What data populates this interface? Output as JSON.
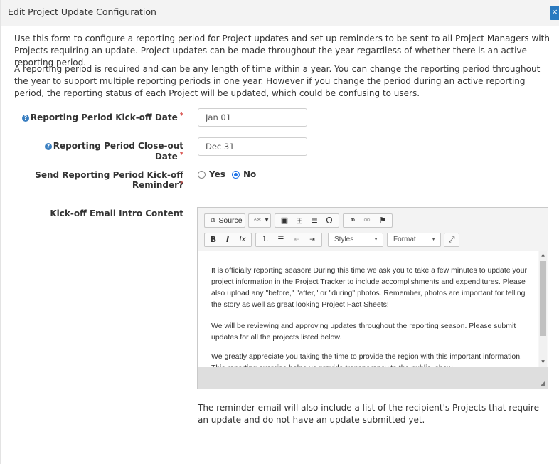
{
  "modal": {
    "title": "Edit Project Update Configuration",
    "close_label": "×"
  },
  "intro": {
    "paragraph1": "Use this form to configure a reporting period for Project updates and set up reminders to be sent to all Project Managers with Projects requiring an update. Project updates can be made throughout the year regardless of whether there is an active reporting period.",
    "paragraph2": "A reporting period is required and can be any length of time within a year. You can change the reporting period throughout the year to support multiple reporting periods in one year. However if you change the period during an active reporting period, the reporting status of each Project will be updated, which could be confusing to users."
  },
  "form": {
    "kickoff_label": "Reporting Period Kick-off Date",
    "kickoff_value": "Jan 01",
    "closeout_label": "Reporting Period Close-out Date",
    "closeout_value": "Dec 31",
    "reminder_label": "Send Reporting Period Kick-off Reminder?",
    "required_mark": "*",
    "help_glyph": "?",
    "reminder_options": [
      "Yes",
      "No"
    ],
    "reminder_selected": "No",
    "email_label": "Kick-off Email Intro Content",
    "footer_note": "The reminder email will also include a list of the recipient's Projects that require an update and do not have an update submitted yet."
  },
  "editor": {
    "toolbar": {
      "source_label": "Source",
      "spell_label": "ᴬᴮᶜ",
      "bold": "B",
      "italic": "I",
      "remove_format": "Ix",
      "styles_label": "Styles",
      "format_label": "Format",
      "omega": "Ω"
    },
    "content": [
      "It is officially reporting season! During this time we ask you to take a few minutes to update your project information in the Project Tracker to include accomplishments and expenditures. Please also upload any \"before,\" \"after,\" or \"during\" photos. Remember, photos are important for telling the story as well as great looking Project Fact Sheets!",
      "We will be reviewing and approving updates throughout the reporting season. Please submit updates for all the projects listed below.",
      "We greatly appreciate you taking the time to provide the region with this important information. This reporting exercise helps us provide transparency to the public, show"
    ]
  }
}
